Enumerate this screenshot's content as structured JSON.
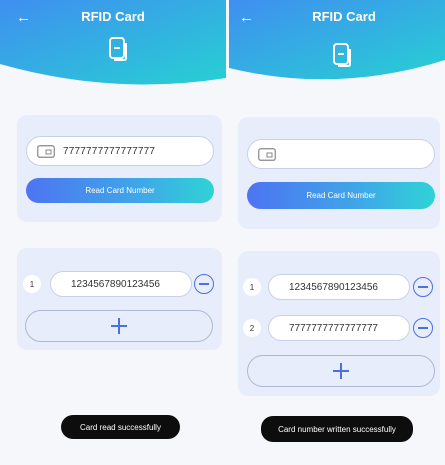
{
  "colors": {
    "header_gradient_start": "#3f8ff0",
    "header_gradient_end": "#27d0d3",
    "accent": "#4d6fe0",
    "toast_bg": "#0d0d0d"
  },
  "left": {
    "header": {
      "title": "RFID Card",
      "back_icon": "back-arrow-icon",
      "card_icon": "card-icon"
    },
    "read_section": {
      "card_number_value": "7777777777777777",
      "read_button_label": "Read Card Number"
    },
    "list": {
      "items": [
        {
          "index": "1",
          "value": "1234567890123456"
        }
      ]
    },
    "toast": "Card read successfully"
  },
  "right": {
    "header": {
      "title": "RFID Card",
      "back_icon": "back-arrow-icon",
      "card_icon": "card-icon"
    },
    "read_section": {
      "card_number_value": "",
      "read_button_label": "Read Card Number"
    },
    "list": {
      "items": [
        {
          "index": "1",
          "value": "1234567890123456"
        },
        {
          "index": "2",
          "value": "7777777777777777"
        }
      ]
    },
    "toast": "Card number written successfully"
  }
}
